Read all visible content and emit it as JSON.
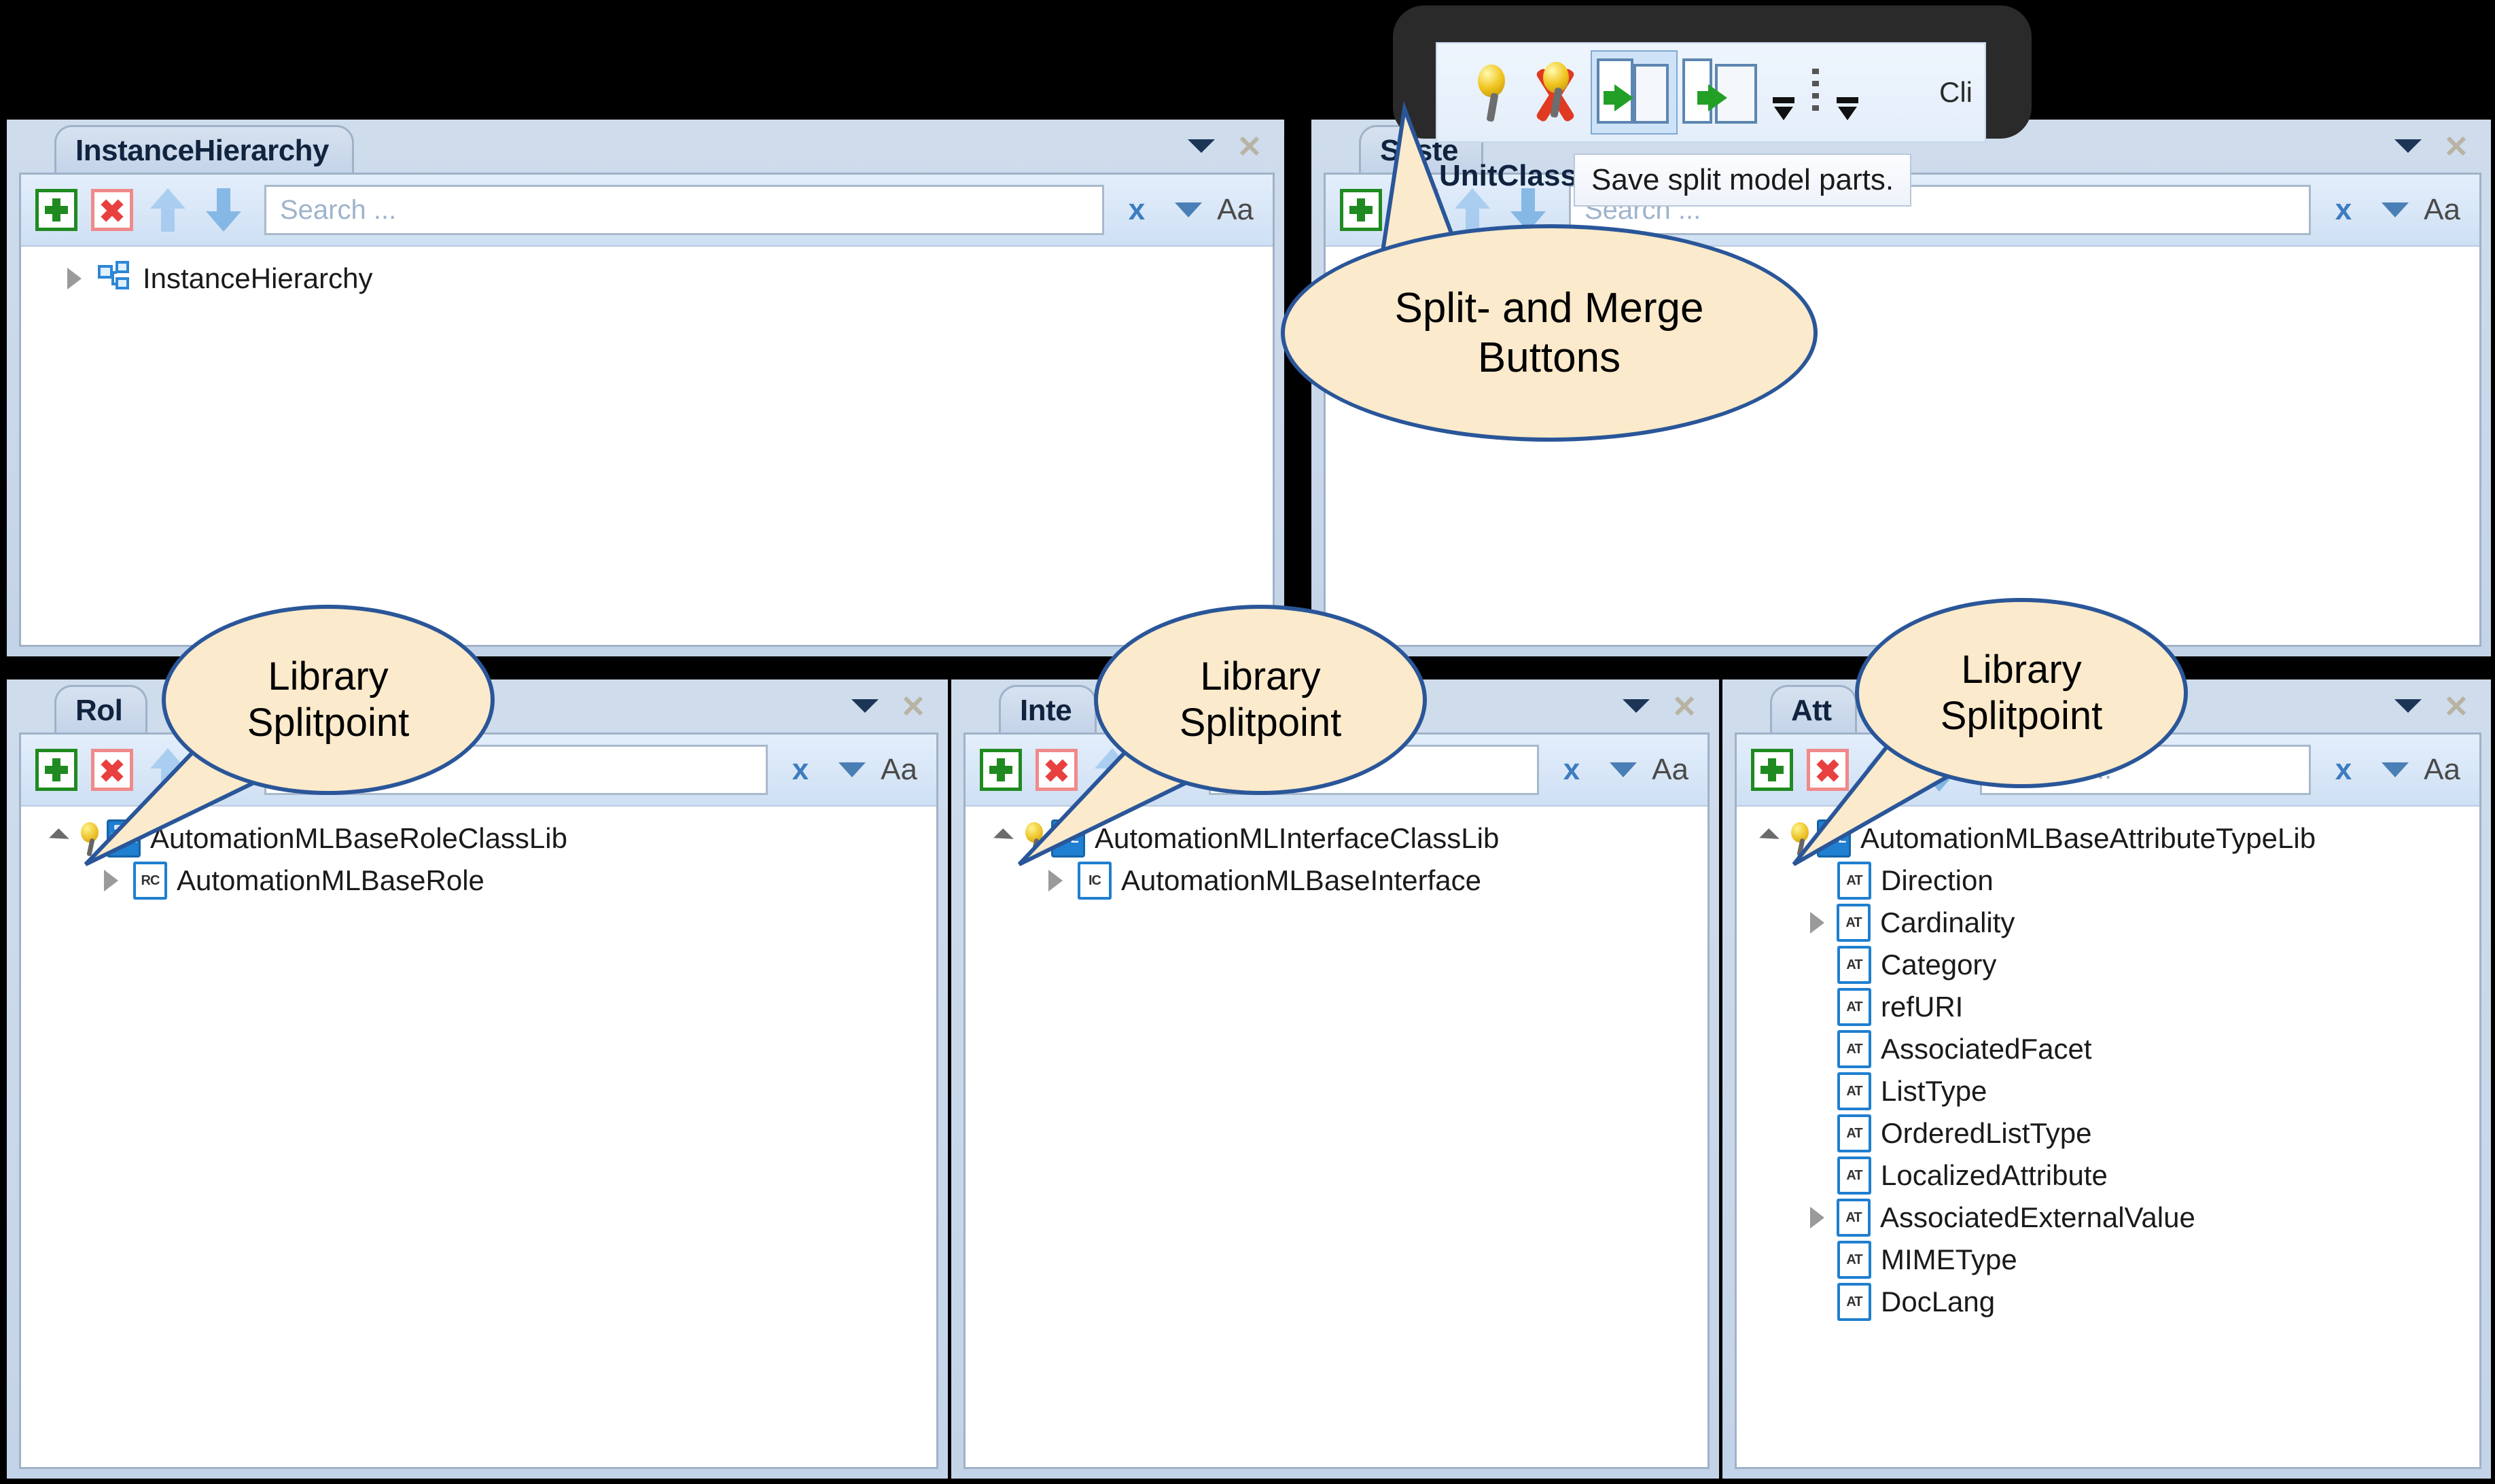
{
  "panels": {
    "instance_hierarchy": {
      "tab_label": "InstanceHierarchy",
      "search_placeholder": "Search ...",
      "clear_label": "x",
      "match_case_label": "Aa",
      "tree": [
        {
          "label": "InstanceHierarchy",
          "icon": "hierarchy-icon",
          "expander": "closed",
          "pinned": false,
          "indent": 0
        }
      ]
    },
    "system_unit": {
      "tab_label": "Syste",
      "inner_label": "UnitClassL",
      "search_placeholder": "Search ...",
      "clear_label": "x",
      "match_case_label": "Aa",
      "tree": []
    },
    "role_class": {
      "tab_label": "Rol",
      "search_placeholder": "Search ...",
      "clear_label": "x",
      "match_case_label": "Aa",
      "tree": [
        {
          "label": "AutomationMLBaseRoleClassLib",
          "icon": "RCL",
          "expander": "open",
          "pinned": true,
          "indent": 0
        },
        {
          "label": "AutomationMLBaseRole",
          "icon": "RC",
          "expander": "closed",
          "pinned": false,
          "indent": 1
        }
      ]
    },
    "interface_class": {
      "tab_label": "Inte",
      "search_placeholder": "Search ...",
      "clear_label": "x",
      "match_case_label": "Aa",
      "tree": [
        {
          "label": "AutomationMLInterfaceClassLib",
          "icon": "ICL",
          "expander": "open",
          "pinned": true,
          "indent": 0
        },
        {
          "label": "AutomationMLBaseInterface",
          "icon": "IC",
          "expander": "closed",
          "pinned": false,
          "indent": 1
        }
      ]
    },
    "attribute_type": {
      "tab_label": "Att",
      "search_placeholder": "Search ...",
      "clear_label": "x",
      "match_case_label": "Aa",
      "tree": [
        {
          "label": "AutomationMLBaseAttributeTypeLib",
          "icon": "ATL",
          "expander": "open",
          "pinned": true,
          "indent": 0
        },
        {
          "label": "Direction",
          "icon": "AT",
          "expander": "none",
          "pinned": false,
          "indent": 1
        },
        {
          "label": "Cardinality",
          "icon": "AT",
          "expander": "closed",
          "pinned": false,
          "indent": 1
        },
        {
          "label": "Category",
          "icon": "AT",
          "expander": "none",
          "pinned": false,
          "indent": 1
        },
        {
          "label": "refURI",
          "icon": "AT",
          "expander": "none",
          "pinned": false,
          "indent": 1
        },
        {
          "label": "AssociatedFacet",
          "icon": "AT",
          "expander": "none",
          "pinned": false,
          "indent": 1
        },
        {
          "label": "ListType",
          "icon": "AT",
          "expander": "none",
          "pinned": false,
          "indent": 1
        },
        {
          "label": "OrderedListType",
          "icon": "AT",
          "expander": "none",
          "pinned": false,
          "indent": 1
        },
        {
          "label": "LocalizedAttribute",
          "icon": "AT",
          "expander": "none",
          "pinned": false,
          "indent": 1
        },
        {
          "label": "AssociatedExternalValue",
          "icon": "AT",
          "expander": "closed",
          "pinned": false,
          "indent": 1
        },
        {
          "label": "MIMEType",
          "icon": "AT",
          "expander": "none",
          "pinned": false,
          "indent": 1
        },
        {
          "label": "DocLang",
          "icon": "AT",
          "expander": "none",
          "pinned": false,
          "indent": 1
        }
      ]
    }
  },
  "float_toolbar": {
    "pin_icon": "pin-icon",
    "unpin_icon": "pin-remove-icon",
    "split_icon": "split-model-icon",
    "merge_icon": "merge-model-icon",
    "overflow_label": "",
    "truncated_text": "Cli"
  },
  "tooltip": {
    "text": "Save split model parts."
  },
  "callouts": [
    {
      "line1": "Split- and Merge",
      "line2": "Buttons"
    },
    {
      "line1": "Library",
      "line2": "Splitpoint"
    },
    {
      "line1": "Library",
      "line2": "Splitpoint"
    },
    {
      "line1": "Library",
      "line2": "Splitpoint"
    }
  ],
  "colors": {
    "callout_fill": "#FBEACB",
    "callout_border": "#2A5699",
    "panel_chrome": "#C4D4E8",
    "accent_blue": "#1F7FD0",
    "add_green": "#1F8A20",
    "delete_red": "#E8403F"
  }
}
